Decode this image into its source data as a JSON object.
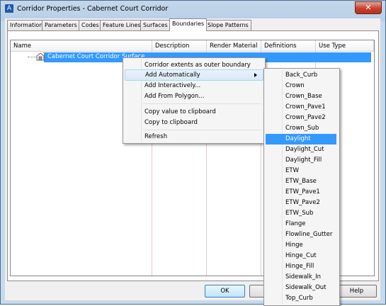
{
  "window": {
    "title": "Corridor Properties - Cabernet Court Corridor",
    "close_glyph": "✕",
    "app_icon": "A"
  },
  "tabs": [
    "Information",
    "Parameters",
    "Codes",
    "Feature Lines",
    "Surfaces",
    "Boundaries",
    "Slope Patterns"
  ],
  "active_tab": "Boundaries",
  "columns": [
    "Name",
    "Description",
    "Render Material",
    "Definitions",
    "Use Type"
  ],
  "row": {
    "name": "Cabernet Court Corridor Surface"
  },
  "context_menu": {
    "items": [
      {
        "label": "Corridor extents as outer boundary"
      },
      {
        "label": "Add Automatically",
        "submenu": true,
        "highlighted": true
      },
      {
        "label": "Add Interactively..."
      },
      {
        "label": "Add From Polygon..."
      },
      {
        "label": "Copy value to clipboard"
      },
      {
        "label": "Copy to clipboard"
      },
      {
        "label": "Refresh"
      }
    ]
  },
  "submenu": {
    "selected": "Daylight",
    "items": [
      "Back_Curb",
      "Crown",
      "Crown_Base",
      "Crown_Pave1",
      "Crown_Pave2",
      "Crown_Sub",
      "Daylight",
      "Daylight_Cut",
      "Daylight_Fill",
      "ETW",
      "ETW_Base",
      "ETW_Pave1",
      "ETW_Pave2",
      "ETW_Sub",
      "Flange",
      "Flowline_Gutter",
      "Hinge",
      "Hinge_Cut",
      "Hinge_Fill",
      "Sidewalk_In",
      "Sidewalk_Out",
      "Top_Curb"
    ]
  },
  "buttons": {
    "ok": "OK",
    "cancel_partial": "C",
    "apply_partial": "y",
    "help": "Help"
  },
  "colors": {
    "selection": "#3399ff",
    "title_bar": "#b9cfe6",
    "close_button": "#c7412c"
  },
  "icons": {
    "surface": "surface-corridor-icon",
    "submenu_arrow": "chevron-right-icon"
  }
}
